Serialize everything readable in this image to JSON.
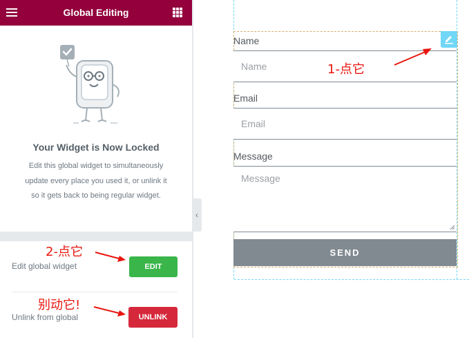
{
  "panel": {
    "title": "Global Editing",
    "menu_icon": "hamburger-icon",
    "apps_icon": "grid-icon",
    "locked_title": "Your Widget is Now Locked",
    "locked_description_lines": [
      "Edit this global widget to simultaneously",
      "update every place you used it, or unlink it",
      "so it gets back to being regular widget."
    ],
    "edit_label": "Edit global widget",
    "edit_button": "EDIT",
    "unlink_label": "Unlink from global",
    "unlink_button": "UNLINK",
    "collapse_icon": "chevron-left-icon"
  },
  "annotations": {
    "step1": "1-点它",
    "step2": "2-点它",
    "step3": "别动它!"
  },
  "form": {
    "name_label": "Name",
    "name_placeholder": "Name",
    "email_label": "Email",
    "email_placeholder": "Email",
    "message_label": "Message",
    "message_placeholder": "Message",
    "send_button": "SEND",
    "edit_handle_icon": "pencil-icon"
  },
  "colors": {
    "topbar": "#93003c",
    "edit_button": "#39b54a",
    "unlink_button": "#d5293b",
    "send_button": "#818a91",
    "annotation": "#e8160f",
    "canvas_guide": "#71d7f7"
  }
}
